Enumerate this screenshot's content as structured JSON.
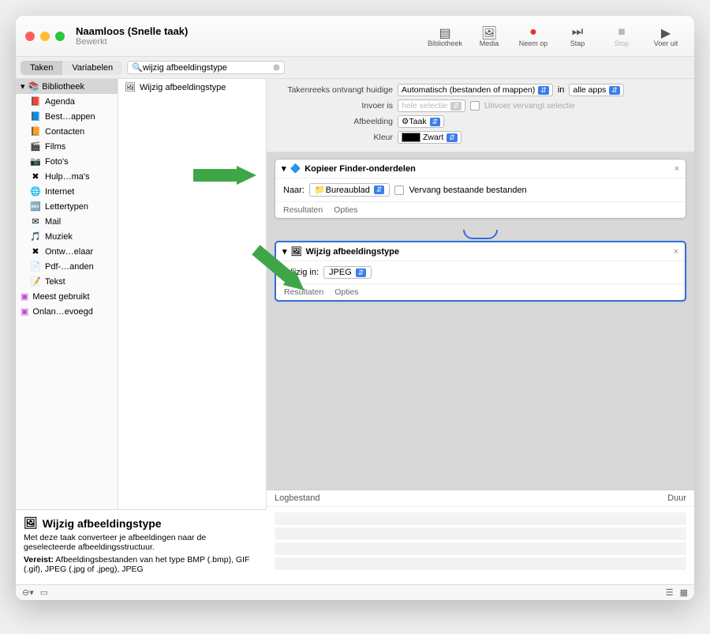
{
  "window": {
    "title": "Naamloos (Snelle taak)",
    "subtitle": "Bewerkt"
  },
  "toolbar": {
    "library": "Bibliotheek",
    "media": "Media",
    "record": "Neem op",
    "step": "Stap",
    "stop": "Stop",
    "run": "Voer uit"
  },
  "segments": {
    "tasks": "Taken",
    "variables": "Variabelen"
  },
  "search": {
    "placeholder": "",
    "value": "wijzig afbeeldingstype"
  },
  "library": {
    "header": "Bibliotheek",
    "items": [
      {
        "icon": "📕",
        "label": "Agenda"
      },
      {
        "icon": "📘",
        "label": "Best…appen"
      },
      {
        "icon": "📙",
        "label": "Contacten"
      },
      {
        "icon": "🎬",
        "label": "Films"
      },
      {
        "icon": "📷",
        "label": "Foto's"
      },
      {
        "icon": "✖",
        "label": "Hulp…ma's"
      },
      {
        "icon": "🌐",
        "label": "Internet"
      },
      {
        "icon": "🔤",
        "label": "Lettertypen"
      },
      {
        "icon": "✉",
        "label": "Mail"
      },
      {
        "icon": "🎵",
        "label": "Muziek"
      },
      {
        "icon": "✖",
        "label": "Ontw…elaar"
      },
      {
        "icon": "📄",
        "label": "Pdf-…anden"
      },
      {
        "icon": "📝",
        "label": "Tekst"
      }
    ],
    "groups": [
      {
        "label": "Meest gebruikt"
      },
      {
        "label": "Onlan…evoegd"
      }
    ]
  },
  "results": {
    "item": "Wijzig afbeeldingstype"
  },
  "config": {
    "row1_label": "Takenreeks ontvangt huidige",
    "row1_value": "Automatisch (bestanden of mappen)",
    "row1_in": "in",
    "row1_apps": "alle apps",
    "row2_label": "Invoer is",
    "row2_value": "hele selectie",
    "row2_check": "Uitvoer vervangt selectie",
    "row3_label": "Afbeelding",
    "row3_value": "Taak",
    "row4_label": "Kleur",
    "row4_value": "Zwart"
  },
  "action1": {
    "title": "Kopieer Finder-onderdelen",
    "naar_label": "Naar:",
    "naar_value": "Bureaublad",
    "replace_label": "Vervang bestaande bestanden",
    "results": "Resultaten",
    "options": "Opties"
  },
  "action2": {
    "title": "Wijzig afbeeldingstype",
    "change_label": "Wijzig in:",
    "change_value": "JPEG",
    "results": "Resultaten",
    "options": "Opties"
  },
  "log": {
    "col1": "Logbestand",
    "col2": "Duur"
  },
  "description": {
    "title": "Wijzig afbeeldingstype",
    "body": "Met deze taak converteer je afbeeldingen naar de geselecteerde afbeeldingsstructuur.",
    "req_label": "Vereist:",
    "req_body": "Afbeeldingsbestanden van het type BMP (.bmp), GIF (.gif), JPEG (.jpg of .jpeg), JPEG"
  }
}
